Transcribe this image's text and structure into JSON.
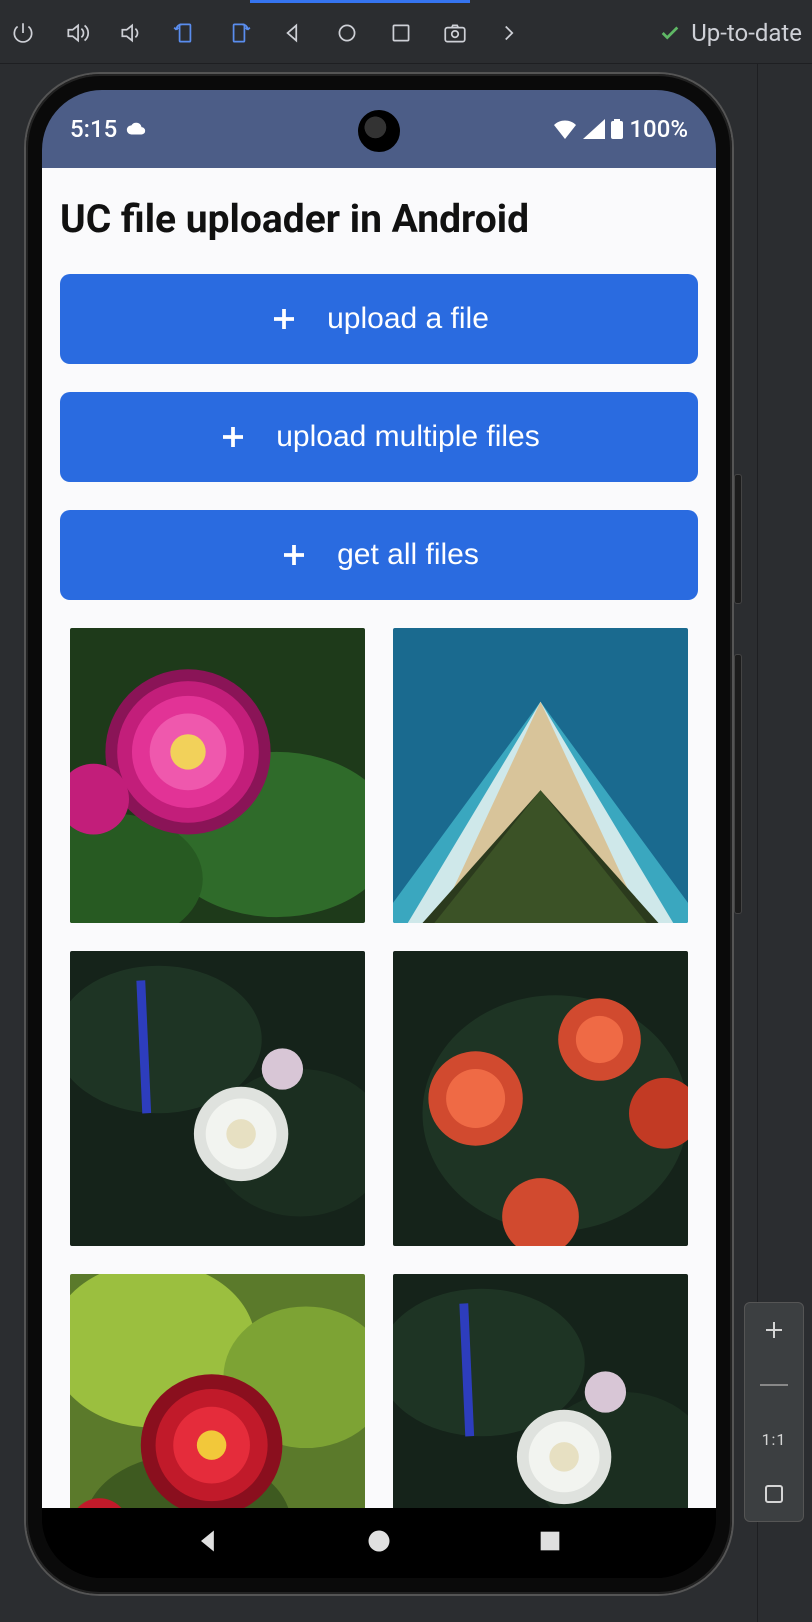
{
  "ide": {
    "status_text": "Up-to-date",
    "zoom_ratio": "1:1"
  },
  "android": {
    "status": {
      "time": "5:15",
      "battery": "100%"
    }
  },
  "app": {
    "title": "UC file uploader in Android",
    "buttons": {
      "upload_single": "upload a file",
      "upload_multiple": "upload multiple files",
      "get_all": "get all files"
    },
    "tiles": [
      {
        "desc": "pink zinnia flower"
      },
      {
        "desc": "aerial beach sandbar"
      },
      {
        "desc": "white dahlia on dark foliage"
      },
      {
        "desc": "orange camellia on dark foliage"
      },
      {
        "desc": "red dahlia on bright green"
      },
      {
        "desc": "white dahlia on dark foliage (copy)"
      }
    ]
  }
}
